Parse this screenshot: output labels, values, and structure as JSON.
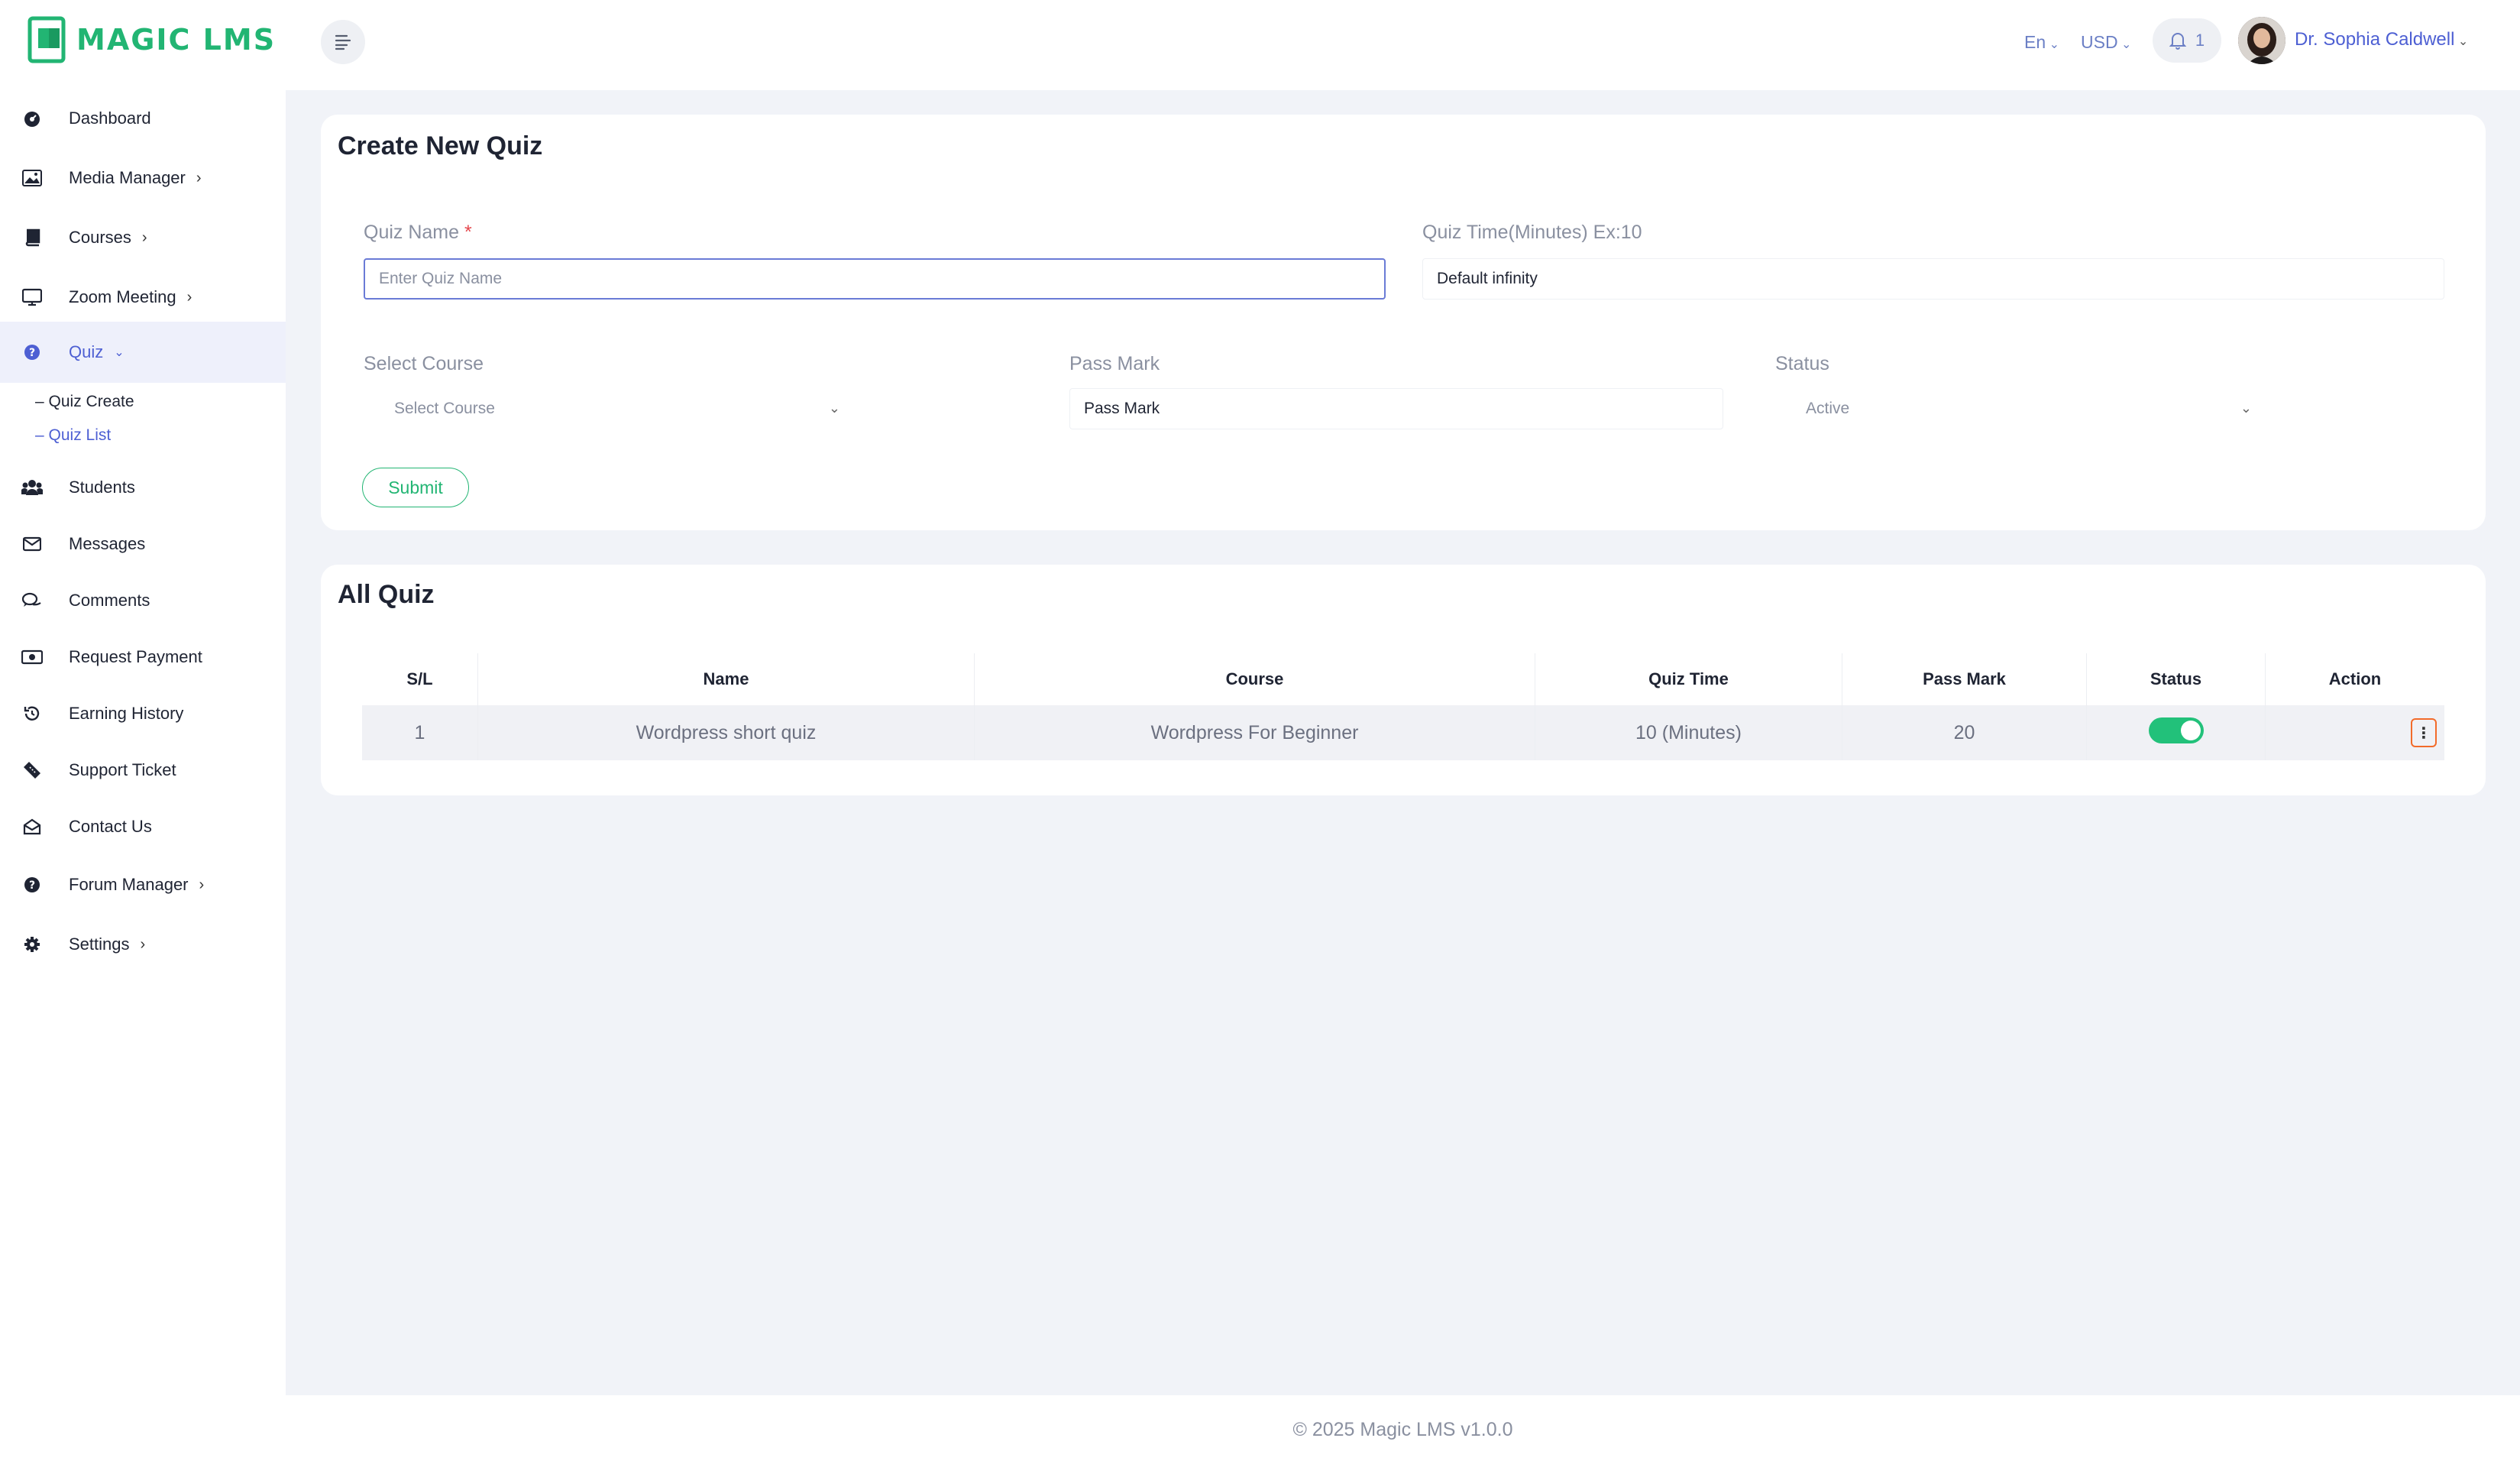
{
  "brand": {
    "logo_text": "MAGIC LMS",
    "accent": "#22b573",
    "primary": "#4d5fd3"
  },
  "sidebar": {
    "items": [
      {
        "label": "Dashboard",
        "icon": "dashboard-icon",
        "has_chevron": false
      },
      {
        "label": "Media Manager",
        "icon": "image-icon",
        "has_chevron": true
      },
      {
        "label": "Courses",
        "icon": "book-icon",
        "has_chevron": true
      },
      {
        "label": "Zoom Meeting",
        "icon": "monitor-icon",
        "has_chevron": true
      },
      {
        "label": "Quiz",
        "icon": "question-circle-icon",
        "has_chevron": true,
        "active": true
      },
      {
        "label": "Students",
        "icon": "users-icon",
        "has_chevron": false
      },
      {
        "label": "Messages",
        "icon": "envelope-icon",
        "has_chevron": false
      },
      {
        "label": "Comments",
        "icon": "comments-icon",
        "has_chevron": false
      },
      {
        "label": "Request Payment",
        "icon": "money-icon",
        "has_chevron": false
      },
      {
        "label": "Earning History",
        "icon": "history-icon",
        "has_chevron": false
      },
      {
        "label": "Support Ticket",
        "icon": "ticket-icon",
        "has_chevron": false
      },
      {
        "label": "Contact Us",
        "icon": "envelope-open-icon",
        "has_chevron": false
      },
      {
        "label": "Forum Manager",
        "icon": "question-circle-icon",
        "has_chevron": true
      },
      {
        "label": "Settings",
        "icon": "gear-icon",
        "has_chevron": true
      }
    ],
    "quiz_sub": [
      {
        "label": "– Quiz Create"
      },
      {
        "label": "– Quiz List",
        "active": true
      }
    ]
  },
  "header": {
    "language": "En",
    "currency": "USD",
    "notification_count": "1",
    "user_name": "Dr. Sophia Caldwell"
  },
  "create_quiz": {
    "title": "Create New Quiz",
    "quiz_name_label": "Quiz Name",
    "required_mark": "*",
    "quiz_name_placeholder": "Enter Quiz Name",
    "quiz_time_label": "Quiz Time(Minutes) Ex:10",
    "quiz_time_placeholder": "Default infinity",
    "course_label": "Select Course",
    "course_value": "Select Course",
    "pass_mark_label": "Pass Mark",
    "pass_mark_placeholder": "Pass Mark",
    "status_label": "Status",
    "status_value": "Active",
    "submit_label": "Submit"
  },
  "all_quiz": {
    "title": "All Quiz",
    "columns": [
      "S/L",
      "Name",
      "Course",
      "Quiz Time",
      "Pass Mark",
      "Status",
      "Action"
    ],
    "rows": [
      {
        "sl": "1",
        "name": "Wordpress short quiz",
        "course": "Wordpress For Beginner",
        "quiz_time": "10 (Minutes)",
        "pass_mark": "20",
        "status_on": true
      }
    ]
  },
  "footer": {
    "text": "© 2025 Magic LMS v1.0.0"
  }
}
